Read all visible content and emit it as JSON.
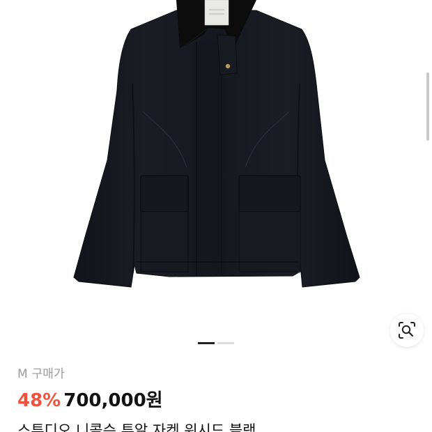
{
  "product": {
    "option_label": "M",
    "price_type_label": "구매가",
    "discount": "48%",
    "price": "700,000원",
    "title": "스튜디오 니콜슨 투알 자켓 워시드 블랙"
  },
  "gallery": {
    "current_index": 1,
    "total": 2,
    "search_button_icon": "image-search-icon"
  },
  "colors": {
    "discount": "#f0533c",
    "price": "#111111",
    "muted_text": "#9a9a9a",
    "jacket": "#171a20",
    "collar": "#0c0c0d"
  }
}
